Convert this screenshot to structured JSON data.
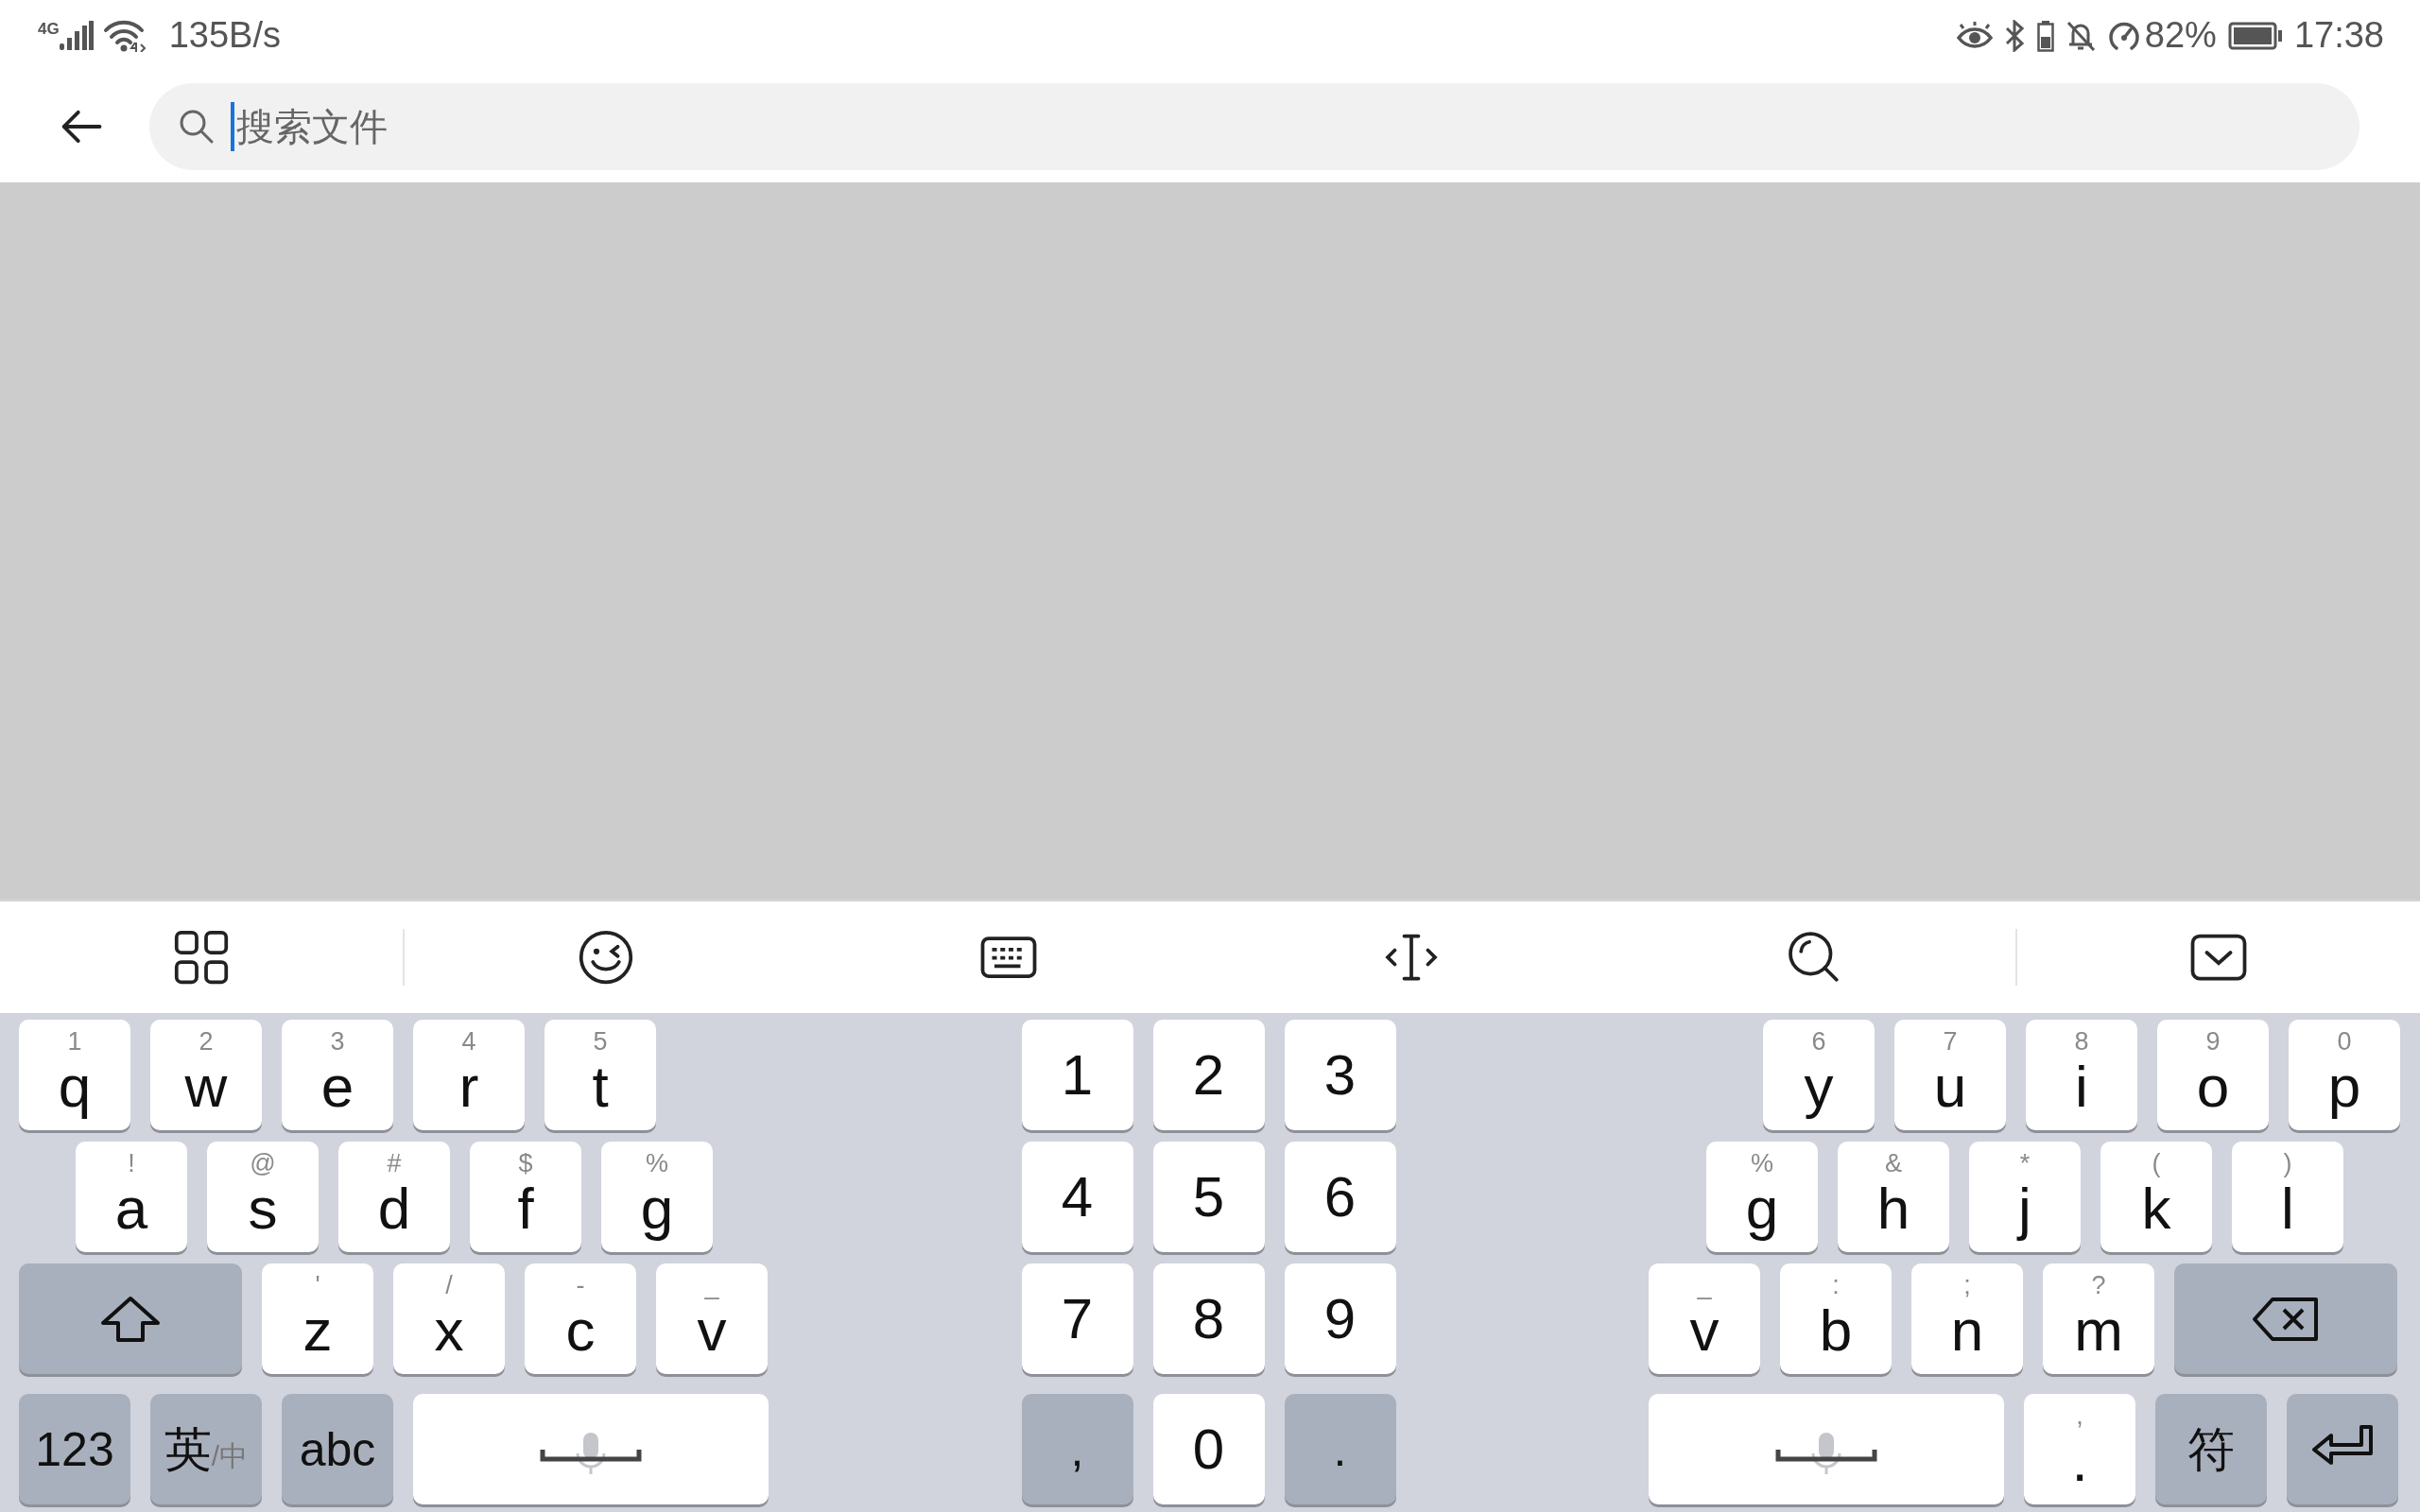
{
  "status_bar": {
    "network": "4G",
    "speed": "135B/s",
    "battery_percent": "82%",
    "time": "17:38"
  },
  "search": {
    "placeholder": "搜索文件",
    "focused": true
  },
  "keyboard": {
    "left": [
      [
        {
          "kind": "letter",
          "label": "q",
          "hint": "1"
        },
        {
          "kind": "letter",
          "label": "w",
          "hint": "2"
        },
        {
          "kind": "letter",
          "label": "e",
          "hint": "3"
        },
        {
          "kind": "letter",
          "label": "r",
          "hint": "4"
        },
        {
          "kind": "letter",
          "label": "t",
          "hint": "5"
        }
      ],
      [
        {
          "kind": "letter",
          "label": "a",
          "hint": "!"
        },
        {
          "kind": "letter",
          "label": "s",
          "hint": "@"
        },
        {
          "kind": "letter",
          "label": "d",
          "hint": "#"
        },
        {
          "kind": "letter",
          "label": "f",
          "hint": "$"
        },
        {
          "kind": "letter",
          "label": "g",
          "hint": "%"
        }
      ],
      [
        {
          "kind": "shift"
        },
        {
          "kind": "letter",
          "label": "z",
          "hint": "'"
        },
        {
          "kind": "letter",
          "label": "x",
          "hint": "/"
        },
        {
          "kind": "letter",
          "label": "c",
          "hint": "-"
        },
        {
          "kind": "letter",
          "label": "v",
          "hint": "_"
        }
      ],
      [
        {
          "kind": "symbol",
          "label": "123"
        },
        {
          "kind": "symbol",
          "label": "英",
          "suffix": "/中"
        },
        {
          "kind": "symbol",
          "label": "abc"
        },
        {
          "kind": "space"
        }
      ]
    ],
    "middle": [
      [
        {
          "kind": "digit",
          "label": "1"
        },
        {
          "kind": "digit",
          "label": "2"
        },
        {
          "kind": "digit",
          "label": "3"
        }
      ],
      [
        {
          "kind": "digit",
          "label": "4"
        },
        {
          "kind": "digit",
          "label": "5"
        },
        {
          "kind": "digit",
          "label": "6"
        }
      ],
      [
        {
          "kind": "digit",
          "label": "7"
        },
        {
          "kind": "digit",
          "label": "8"
        },
        {
          "kind": "digit",
          "label": "9"
        }
      ],
      [
        {
          "kind": "symbol",
          "label": ","
        },
        {
          "kind": "digit",
          "label": "0"
        },
        {
          "kind": "symbol",
          "label": "."
        }
      ]
    ],
    "right": [
      [
        {
          "kind": "letter",
          "label": "y",
          "hint": "6"
        },
        {
          "kind": "letter",
          "label": "u",
          "hint": "7"
        },
        {
          "kind": "letter",
          "label": "i",
          "hint": "8"
        },
        {
          "kind": "letter",
          "label": "o",
          "hint": "9"
        },
        {
          "kind": "letter",
          "label": "p",
          "hint": "0"
        }
      ],
      [
        {
          "kind": "letter",
          "label": "g",
          "hint": "%"
        },
        {
          "kind": "letter",
          "label": "h",
          "hint": "&"
        },
        {
          "kind": "letter",
          "label": "j",
          "hint": "*"
        },
        {
          "kind": "letter",
          "label": "k",
          "hint": "("
        },
        {
          "kind": "letter",
          "label": "l",
          "hint": ")"
        }
      ],
      [
        {
          "kind": "letter",
          "label": "v",
          "hint": "_"
        },
        {
          "kind": "letter",
          "label": "b",
          "hint": ":"
        },
        {
          "kind": "letter",
          "label": "n",
          "hint": ";"
        },
        {
          "kind": "letter",
          "label": "m",
          "hint": "?"
        },
        {
          "kind": "backspace"
        }
      ],
      [
        {
          "kind": "space"
        },
        {
          "kind": "letter",
          "label": ".",
          "hint": ","
        },
        {
          "kind": "symbol",
          "label": "符"
        },
        {
          "kind": "enter"
        }
      ]
    ]
  }
}
